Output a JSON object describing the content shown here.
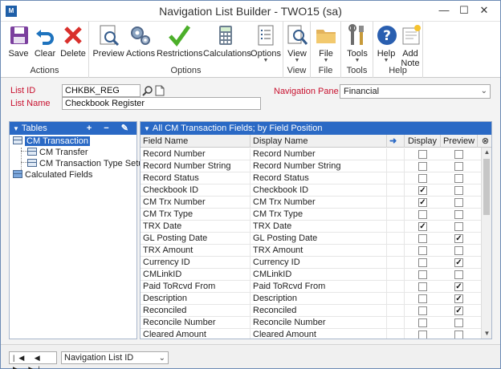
{
  "window": {
    "title": "Navigation List Builder  -  TWO15 (sa)"
  },
  "ribbon": {
    "groups": [
      {
        "label": "Actions",
        "buttons": [
          "Save",
          "Clear",
          "Delete"
        ]
      },
      {
        "label": "Options",
        "buttons": [
          "Preview",
          "Actions",
          "Restrictions",
          "Calculations",
          "Options"
        ]
      },
      {
        "label": "View",
        "buttons": [
          "View"
        ]
      },
      {
        "label": "File",
        "buttons": [
          "File"
        ]
      },
      {
        "label": "Tools",
        "buttons": [
          "Tools"
        ]
      },
      {
        "label": "Help",
        "buttons": [
          "Help",
          "Add\nNote"
        ]
      }
    ],
    "add_note_line1": "Add",
    "add_note_line2": "Note"
  },
  "form": {
    "list_id_label": "List ID",
    "list_id_value": "CHKBK_REG",
    "list_name_label": "List Name",
    "list_name_value": "Checkbook Register",
    "nav_pane_label": "Navigation Pane",
    "nav_pane_value": "Financial"
  },
  "tables": {
    "header": "Tables",
    "tools": "+ − ✎",
    "items": [
      {
        "label": "CM Transaction"
      },
      {
        "label": "CM Transfer"
      },
      {
        "label": "CM Transaction Type Setup"
      },
      {
        "label": "Calculated Fields"
      }
    ]
  },
  "fields": {
    "header": "All CM Transaction Fields; by Field Position",
    "columns": {
      "field_name": "Field Name",
      "display_name": "Display Name",
      "display": "Display",
      "preview": "Preview"
    },
    "rows": [
      {
        "field": "Record Number",
        "display_name": "Record Number",
        "display": false,
        "preview": false
      },
      {
        "field": "Record Number String",
        "display_name": "Record Number String",
        "display": false,
        "preview": false
      },
      {
        "field": "Record Status",
        "display_name": "Record Status",
        "display": false,
        "preview": false
      },
      {
        "field": "Checkbook ID",
        "display_name": "Checkbook ID",
        "display": true,
        "preview": false
      },
      {
        "field": "CM Trx Number",
        "display_name": "CM Trx Number",
        "display": true,
        "preview": false
      },
      {
        "field": "CM Trx Type",
        "display_name": "CM Trx Type",
        "display": false,
        "preview": false
      },
      {
        "field": "TRX Date",
        "display_name": "TRX Date",
        "display": true,
        "preview": false
      },
      {
        "field": "GL Posting Date",
        "display_name": "GL Posting Date",
        "display": false,
        "preview": true
      },
      {
        "field": "TRX Amount",
        "display_name": "TRX Amount",
        "display": false,
        "preview": false
      },
      {
        "field": "Currency ID",
        "display_name": "Currency ID",
        "display": false,
        "preview": true
      },
      {
        "field": "CMLinkID",
        "display_name": "CMLinkID",
        "display": false,
        "preview": false
      },
      {
        "field": "Paid ToRcvd From",
        "display_name": "Paid ToRcvd From",
        "display": false,
        "preview": true
      },
      {
        "field": "Description",
        "display_name": "Description",
        "display": false,
        "preview": true
      },
      {
        "field": "Reconciled",
        "display_name": "Reconciled",
        "display": false,
        "preview": true
      },
      {
        "field": "Reconcile Number",
        "display_name": "Reconcile Number",
        "display": false,
        "preview": false
      },
      {
        "field": "Cleared Amount",
        "display_name": "Cleared Amount",
        "display": false,
        "preview": false
      }
    ]
  },
  "footer": {
    "sort_value": "Navigation List ID",
    "nav_glyphs": "|◀ ◀ ▶ ▶|"
  },
  "colors": {
    "accent": "#2a69c5",
    "required_label": "#c8102e",
    "save_icon": "#7b3f9e",
    "clear_icon": "#1e73be",
    "delete_icon": "#d9302c",
    "restrictions_icon": "#4caf2a"
  }
}
